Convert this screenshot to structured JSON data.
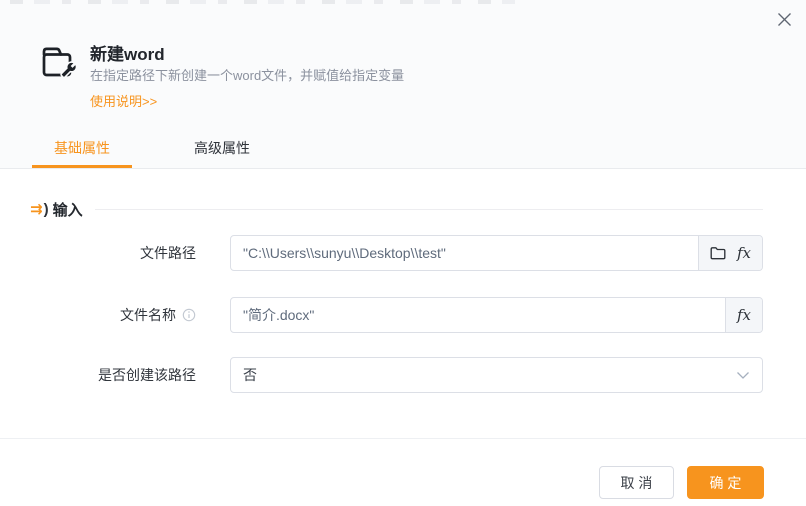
{
  "dialog": {
    "header": {
      "title": "新建word",
      "description": "在指定路径下新创建一个word文件，并赋值给指定变量",
      "help_link": "使用说明>>"
    },
    "tabs": [
      {
        "label": "基础属性",
        "active": true
      },
      {
        "label": "高级属性",
        "active": false
      }
    ],
    "section": {
      "icon_glyph": "⇉",
      "icon_paren": ")",
      "title": "输入"
    },
    "fields": [
      {
        "label": "文件路径",
        "value": "\"C:\\\\Users\\\\sunyu\\\\Desktop\\\\test\"",
        "type": "text-input",
        "suffix_icons": [
          "folder-icon",
          "fx-icon"
        ]
      },
      {
        "label": "文件名称",
        "value": "\"简介.docx\"",
        "type": "text-input",
        "has_info_icon": true,
        "suffix_icons": [
          "fx-icon"
        ]
      },
      {
        "label": "是否创建该路径",
        "value": "否",
        "type": "select"
      }
    ],
    "fx_glyph": "fx",
    "footer": {
      "cancel_label": "取 消",
      "confirm_label": "确 定"
    },
    "colors": {
      "accent": "#f7941e"
    }
  }
}
